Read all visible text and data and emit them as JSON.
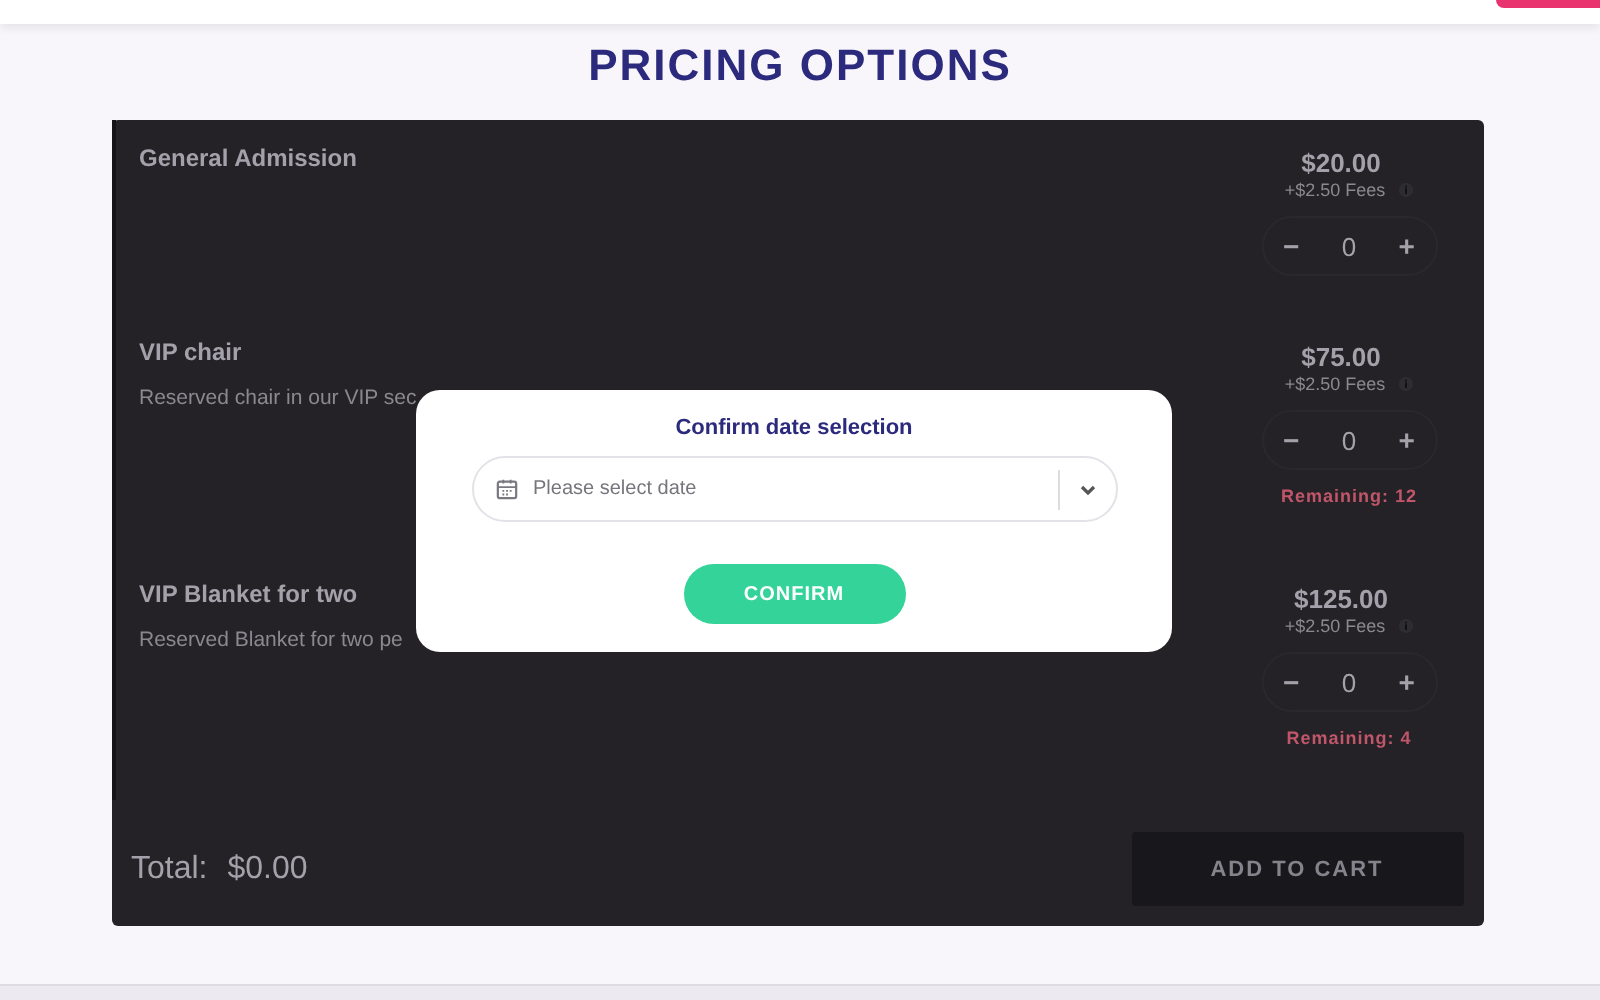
{
  "title": "PRICING OPTIONS",
  "options": [
    {
      "name": "General Admission",
      "price": "$20.00",
      "fees": "+$2.50 Fees",
      "minus": "−",
      "quantity": "0",
      "plus": "+"
    },
    {
      "name": "VIP chair",
      "description": "Reserved chair in our VIP sec",
      "price": "$75.00",
      "fees": "+$2.50 Fees",
      "minus": "−",
      "quantity": "0",
      "plus": "+",
      "remaining": "Remaining: 12"
    },
    {
      "name": "VIP Blanket for two",
      "description": "Reserved Blanket for two pe",
      "price": "$125.00",
      "fees": "+$2.50 Fees",
      "minus": "−",
      "quantity": "0",
      "plus": "+",
      "remaining": "Remaining: 4"
    }
  ],
  "total": {
    "label": "Total:",
    "value": "$0.00"
  },
  "add_to_cart": {
    "label": "ADD TO CART",
    "disabled": true
  },
  "dialog": {
    "title": "Confirm date selection",
    "placeholder": "Please select date",
    "button": "CONFIRM"
  }
}
